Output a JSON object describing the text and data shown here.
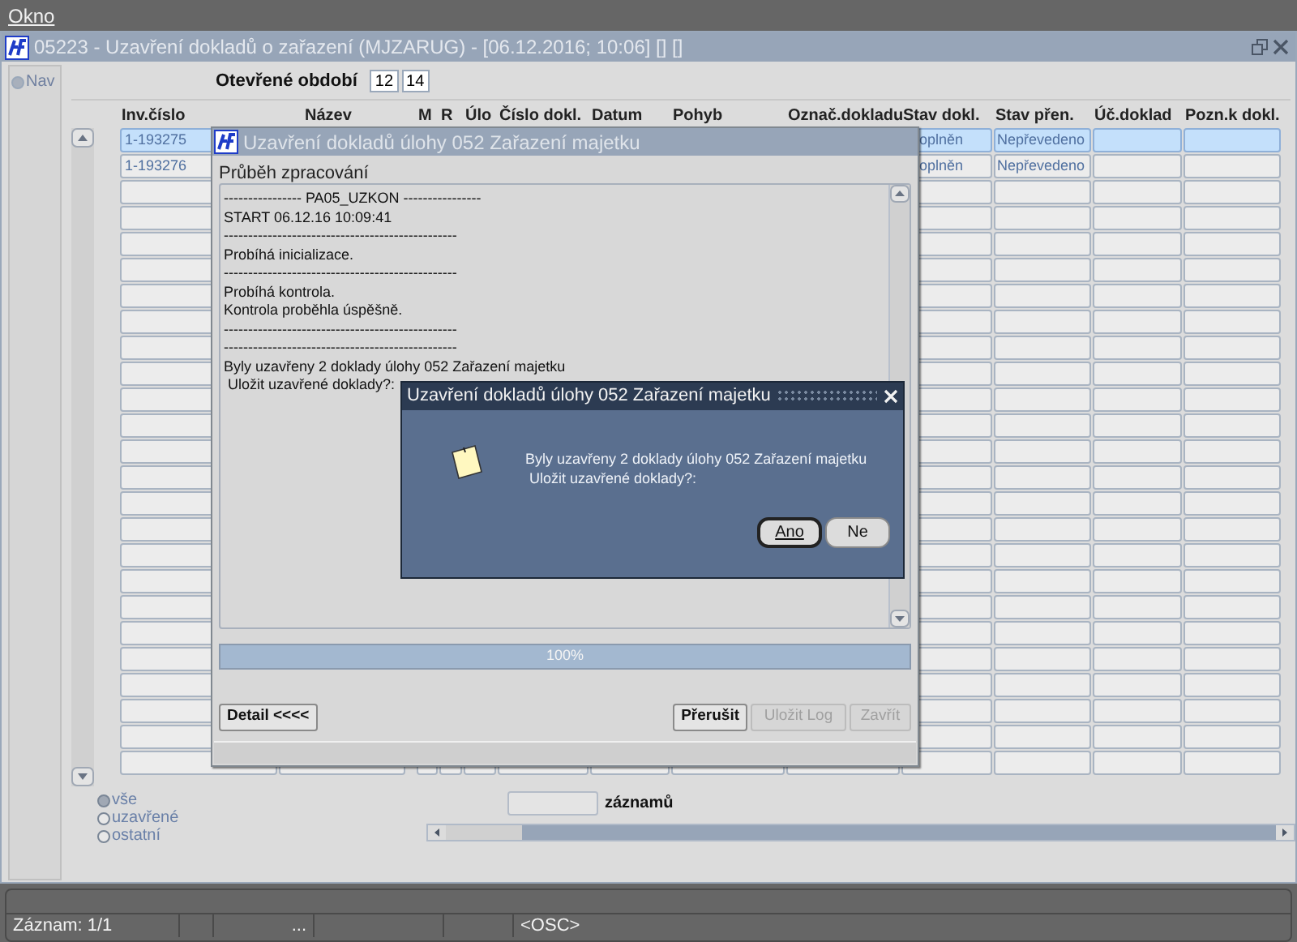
{
  "menu_bar": {
    "items": [
      {
        "label": "Okno"
      }
    ]
  },
  "window": {
    "title": "05223 - Uzavření dokladů o zařazení (MJZARUG) - [06.12.2016; 10:06] [] []"
  },
  "nav": {
    "label": "Nav",
    "selected": true
  },
  "period": {
    "label": "Otevřené období",
    "values": [
      "12",
      "14"
    ]
  },
  "table": {
    "columns": [
      "Inv.číslo",
      "Název",
      "M",
      "R",
      "Úlo",
      "Číslo dokl.",
      "Datum",
      "Pohyb",
      "Označ.dokladu",
      "Stav dokl.",
      "Stav přen.",
      "Úč.doklad",
      "Pozn.k dokl."
    ],
    "rows": [
      {
        "selected": true,
        "inv_cislo": "1-193275",
        "stav_dokl": "oplněn",
        "stav_pren": "Nepřevedeno"
      },
      {
        "selected": false,
        "inv_cislo": "1-193276",
        "stav_dokl": "oplněn",
        "stav_pren": "Nepřevedeno"
      }
    ]
  },
  "filter": [
    {
      "label": "vše",
      "selected": true
    },
    {
      "label": "uzavřené",
      "selected": false
    },
    {
      "label": "ostatní",
      "selected": false
    }
  ],
  "records": {
    "label": "záznamů"
  },
  "status_bar": {
    "record": "Záznam: 1/1",
    "segment_3": "...",
    "segment_6": "<OSC>"
  },
  "progress_dialog": {
    "title": "Uzavření dokladů úlohy 052 Zařazení majetku",
    "heading": "Průběh zpracování",
    "log": [
      "---------------- PA05_UZKON ----------------",
      "START 06.12.16 10:09:41",
      "------------------------------------------------",
      "Probíhá inicializace.",
      "------------------------------------------------",
      "Probíhá kontrola.",
      "Kontrola proběhla úspěšně.",
      "------------------------------------------------",
      "------------------------------------------------",
      "Byly uzavřeny 2 doklady úlohy 052 Zařazení majetku",
      " Uložit uzavřené doklady?:"
    ],
    "progress": {
      "level": 1,
      "label": "100%"
    },
    "buttons": [
      {
        "label": "Detail <<<<",
        "kind": "left",
        "disabled": false
      },
      {
        "label": "Přerušit",
        "kind": "right",
        "disabled": false
      },
      {
        "label": "Uložit Log",
        "kind": "right",
        "disabled": true
      },
      {
        "label": "Zavřít",
        "kind": "right",
        "disabled": true
      }
    ]
  },
  "alert": {
    "title": "Uzavření dokladů úlohy 052 Zařazení majetku",
    "message": [
      "Byly uzavřeny 2 doklady úlohy 052 Zařazení majetku",
      " Uložit uzavřené doklady?:"
    ],
    "buttons": [
      {
        "label": "Ano",
        "selected": true
      },
      {
        "label": "Ne",
        "selected": false
      }
    ]
  }
}
